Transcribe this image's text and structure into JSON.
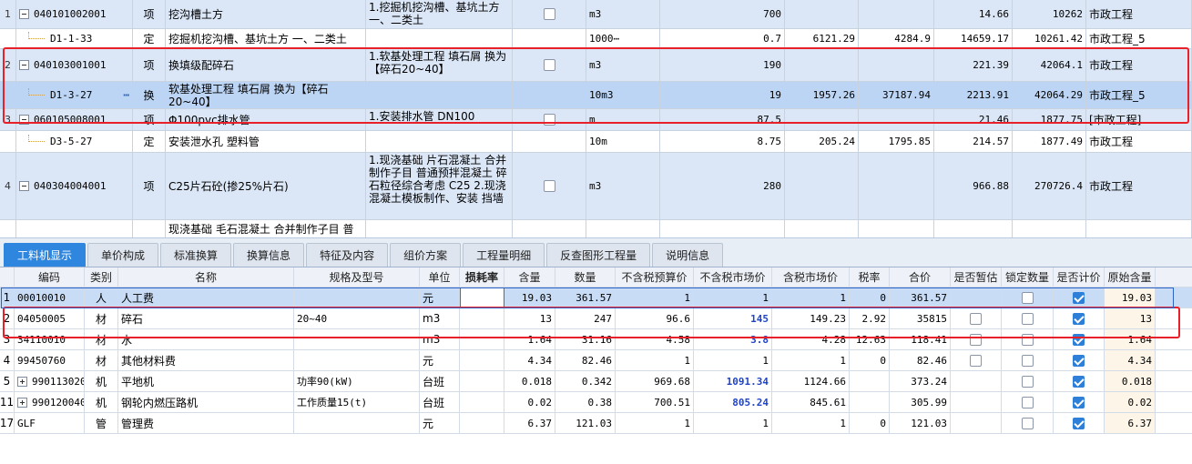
{
  "top_rows": [
    {
      "num": "1",
      "code": "040101002001",
      "expander": "minus",
      "cat": "项",
      "name": "挖沟槽土方",
      "feature": "1.挖掘机挖沟槽、基坑土方一、二类土",
      "check": false,
      "unit": "m3",
      "qty": "700",
      "c9": "",
      "c10": "",
      "c11": "14.66",
      "c12": "10262",
      "prof": "市政工程"
    },
    {
      "num": "",
      "code": "D1-1-33",
      "expander": "",
      "cat": "定",
      "name": "挖掘机挖沟槽、基坑土方 一、二类土",
      "feature": "",
      "check": null,
      "unit": "1000⋯",
      "qty": "0.7",
      "c9": "6121.29",
      "c10": "4284.9",
      "c11": "14659.17",
      "c12": "10261.42",
      "prof": "市政工程_5"
    },
    {
      "num": "2",
      "code": "040103001001",
      "expander": "minus",
      "cat": "项",
      "name": "换填级配碎石",
      "feature": "1.软基处理工程 填石屑  换为【碎石20~40】",
      "check": false,
      "unit": "m3",
      "qty": "190",
      "c9": "",
      "c10": "",
      "c11": "221.39",
      "c12": "42064.1",
      "prof": "市政工程"
    },
    {
      "num": "",
      "code": "D1-3-27",
      "expander": "",
      "cat": "换",
      "name": "软基处理工程 填石屑  换为【碎石20~40】",
      "feature": "",
      "check": null,
      "unit": "10m3",
      "qty": "19",
      "c9": "1957.26",
      "c10": "37187.94",
      "c11": "2213.91",
      "c12": "42064.29",
      "prof": "市政工程_5"
    },
    {
      "num": "3",
      "code": "060105008001",
      "expander": "minus",
      "cat": "项",
      "name": "Φ100pvc排水管",
      "feature": "1.安装排水管 DN100",
      "check": false,
      "unit": "m",
      "qty": "87.5",
      "c9": "",
      "c10": "",
      "c11": "21.46",
      "c12": "1877.75",
      "prof": "[市政工程]"
    },
    {
      "num": "",
      "code": "D3-5-27",
      "expander": "",
      "cat": "定",
      "name": "安装泄水孔 塑料管",
      "feature": "",
      "check": null,
      "unit": "10m",
      "qty": "8.75",
      "c9": "205.24",
      "c10": "1795.85",
      "c11": "214.57",
      "c12": "1877.49",
      "prof": "市政工程"
    },
    {
      "num": "4",
      "code": "040304004001",
      "expander": "minus",
      "cat": "项",
      "name": "C25片石砼(掺25%片石)",
      "feature": "1.现浇基础 片石混凝土  合并制作子目 普通预拌混凝土 碎石粒径综合考虑 C25\n2.现浇混凝土模板制作、安装 挡墙",
      "check": false,
      "unit": "m3",
      "qty": "280",
      "c9": "",
      "c10": "",
      "c11": "966.88",
      "c12": "270726.4",
      "prof": "市政工程"
    },
    {
      "num": "",
      "code": "",
      "expander": "",
      "cat": "",
      "name": "现浇基础 毛石混凝土  合并制作子目 普",
      "feature": "",
      "check": null,
      "unit": "",
      "qty": "",
      "c9": "",
      "c10": "",
      "c11": "",
      "c12": "",
      "prof": ""
    }
  ],
  "tabs": [
    "工料机显示",
    "单价构成",
    "标准换算",
    "换算信息",
    "特征及内容",
    "组价方案",
    "工程量明细",
    "反查图形工程量",
    "说明信息"
  ],
  "bottom_headers": [
    "",
    "编码",
    "类别",
    "名称",
    "规格及型号",
    "单位",
    "损耗率",
    "含量",
    "数量",
    "不含税预算价",
    "不含税市场价",
    "含税市场价",
    "税率",
    "合价",
    "是否暂估",
    "锁定数量",
    "是否计价",
    "原始含量"
  ],
  "bottom_rows": [
    {
      "num": "1",
      "expander": "",
      "code": "00010010",
      "cat": "人",
      "name": "人工费",
      "spec": "",
      "unit": "元",
      "loss": "",
      "content": "19.03",
      "qty": "361.57",
      "budget": "1",
      "market": "1",
      "market_emph": false,
      "tax_market": "1",
      "tax": "0",
      "total": "361.57",
      "est": null,
      "lock": false,
      "priced": true,
      "orig": "19.03"
    },
    {
      "num": "2",
      "expander": "",
      "code": "04050005",
      "cat": "材",
      "name": "碎石",
      "spec": "20~40",
      "unit": "m3",
      "loss": "",
      "content": "13",
      "qty": "247",
      "budget": "96.6",
      "market": "145",
      "market_emph": true,
      "tax_market": "149.23",
      "tax": "2.92",
      "total": "35815",
      "est": false,
      "lock": false,
      "priced": true,
      "orig": "13"
    },
    {
      "num": "3",
      "expander": "",
      "code": "34110010",
      "cat": "材",
      "name": "水",
      "spec": "",
      "unit": "m3",
      "loss": "",
      "content": "1.64",
      "qty": "31.16",
      "budget": "4.58",
      "market": "3.8",
      "market_emph": true,
      "tax_market": "4.28",
      "tax": "12.63",
      "total": "118.41",
      "est": false,
      "lock": false,
      "priced": true,
      "orig": "1.64"
    },
    {
      "num": "4",
      "expander": "",
      "code": "99450760",
      "cat": "材",
      "name": "其他材料费",
      "spec": "",
      "unit": "元",
      "loss": "",
      "content": "4.34",
      "qty": "82.46",
      "budget": "1",
      "market": "1",
      "market_emph": false,
      "tax_market": "1",
      "tax": "0",
      "total": "82.46",
      "est": false,
      "lock": false,
      "priced": true,
      "orig": "4.34"
    },
    {
      "num": "5",
      "expander": "plus",
      "code": "990113020",
      "cat": "机",
      "name": "平地机",
      "spec": "功率90(kW)",
      "unit": "台班",
      "loss": "",
      "content": "0.018",
      "qty": "0.342",
      "budget": "969.68",
      "market": "1091.34",
      "market_emph": true,
      "tax_market": "1124.66",
      "tax": "",
      "total": "373.24",
      "est": null,
      "lock": false,
      "priced": true,
      "orig": "0.018"
    },
    {
      "num": "11",
      "expander": "plus",
      "code": "990120040",
      "cat": "机",
      "name": "钢轮内燃压路机",
      "spec": "工作质量15(t)",
      "unit": "台班",
      "loss": "",
      "content": "0.02",
      "qty": "0.38",
      "budget": "700.51",
      "market": "805.24",
      "market_emph": true,
      "tax_market": "845.61",
      "tax": "",
      "total": "305.99",
      "est": null,
      "lock": false,
      "priced": true,
      "orig": "0.02"
    },
    {
      "num": "17",
      "expander": "",
      "code": "GLF",
      "cat": "管",
      "name": "管理费",
      "spec": "",
      "unit": "元",
      "loss": "",
      "content": "6.37",
      "qty": "121.03",
      "budget": "1",
      "market": "1",
      "market_emph": false,
      "tax_market": "1",
      "tax": "0",
      "total": "121.03",
      "est": null,
      "lock": false,
      "priced": true,
      "orig": "6.37"
    }
  ],
  "colors": {
    "highlight": "#e8202a",
    "active_tab": "#2e86de",
    "row_blue": "#dbe7f7",
    "row_selected": "#bcd5f5",
    "emphasis_blue": "#1f44c8"
  }
}
